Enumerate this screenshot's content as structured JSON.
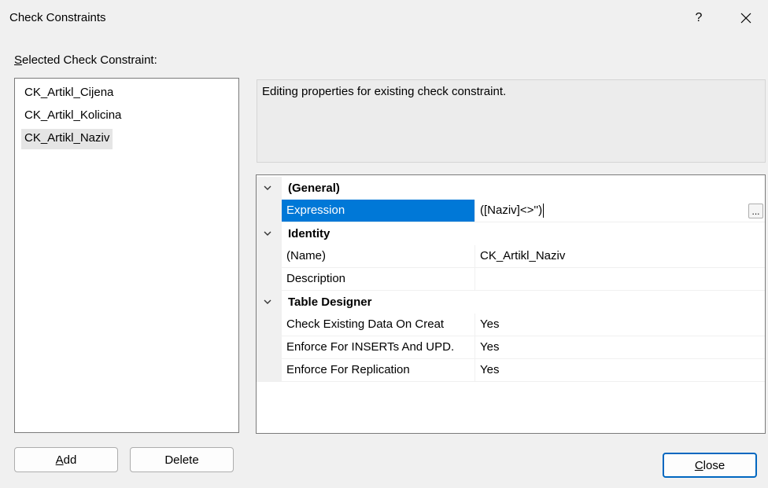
{
  "window": {
    "title": "Check Constraints",
    "help_label": "?"
  },
  "selected_label": {
    "underlined": "S",
    "rest": "elected Check Constraint:"
  },
  "constraints": [
    {
      "label": "CK_Artikl_Cijena",
      "selected": false
    },
    {
      "label": "CK_Artikl_Kolicina",
      "selected": false
    },
    {
      "label": "CK_Artikl_Naziv",
      "selected": true
    }
  ],
  "description": "Editing properties for existing check constraint.",
  "property_grid": {
    "general": {
      "label": "(General)",
      "expression_name": "Expression",
      "expression_value": "([Naziv]<>'')",
      "ellipsis": "..."
    },
    "identity": {
      "label": "Identity",
      "name_label": "(Name)",
      "name_value": "CK_Artikl_Naziv",
      "description_label": "Description",
      "description_value": ""
    },
    "table_designer": {
      "label": "Table Designer",
      "check_existing_label": "Check Existing Data On Creat",
      "check_existing_value": "Yes",
      "enforce_inserts_label": "Enforce For INSERTs And UPD.",
      "enforce_inserts_value": "Yes",
      "enforce_replication_label": "Enforce For Replication",
      "enforce_replication_value": "Yes"
    }
  },
  "buttons": {
    "add": {
      "underlined": "A",
      "rest": "dd"
    },
    "delete": "Delete",
    "close": {
      "underlined": "C",
      "rest": "lose"
    }
  }
}
